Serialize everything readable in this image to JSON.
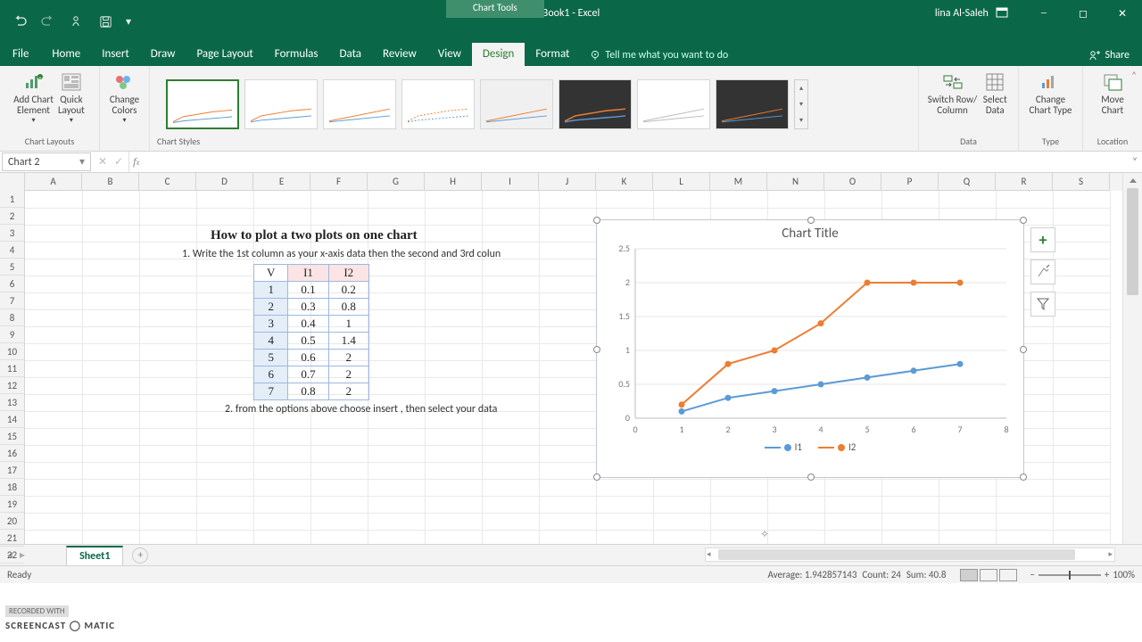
{
  "title": "Book1 - Excel",
  "chart_tools": "Chart Tools",
  "account": "lina Al-Saleh",
  "file": "File",
  "tabs": [
    "Home",
    "Insert",
    "Draw",
    "Page Layout",
    "Formulas",
    "Data",
    "Review",
    "View",
    "Design",
    "Format"
  ],
  "active_tab": "Design",
  "tellme_placeholder": "Tell me what you want to do",
  "share": "Share",
  "ribbon": {
    "add_chart_element": "Add Chart\nElement",
    "quick_layout": "Quick\nLayout",
    "change_colors": "Change\nColors",
    "group_chart_layouts": "Chart Layouts",
    "group_chart_styles": "Chart Styles",
    "switch_rowcol": "Switch Row/\nColumn",
    "select_data": "Select\nData",
    "group_data": "Data",
    "change_chart_type": "Change\nChart Type",
    "group_type": "Type",
    "move_chart": "Move\nChart",
    "group_location": "Location"
  },
  "namebox": "Chart 2",
  "columns": [
    "A",
    "B",
    "C",
    "D",
    "E",
    "F",
    "G",
    "H",
    "I",
    "J",
    "K",
    "L",
    "M",
    "N",
    "O",
    "P",
    "Q",
    "R",
    "S"
  ],
  "rows_shown": 22,
  "sheet": {
    "heading": "How to plot a two plots on one chart",
    "instr1": "1. Write the 1st column as your x-axis data then the second and 3rd colun",
    "instr2": "2. from the options above choose insert , then select your data",
    "table_headers": [
      "V",
      "I1",
      "I2"
    ],
    "table_rows": [
      [
        "1",
        "0.1",
        "0.2"
      ],
      [
        "2",
        "0.3",
        "0.8"
      ],
      [
        "3",
        "0.4",
        "1"
      ],
      [
        "4",
        "0.5",
        "1.4"
      ],
      [
        "5",
        "0.6",
        "2"
      ],
      [
        "6",
        "0.7",
        "2"
      ],
      [
        "7",
        "0.8",
        "2"
      ]
    ]
  },
  "chart_title": "Chart Title",
  "legend": {
    "s1": "I1",
    "s2": "I2"
  },
  "chart_data": {
    "type": "line",
    "x": [
      1,
      2,
      3,
      4,
      5,
      6,
      7
    ],
    "series": [
      {
        "name": "I1",
        "values": [
          0.1,
          0.3,
          0.4,
          0.5,
          0.6,
          0.7,
          0.8
        ],
        "color": "#5b9bd5"
      },
      {
        "name": "I2",
        "values": [
          0.2,
          0.8,
          1,
          1.4,
          2,
          2,
          2
        ],
        "color": "#ed7d31"
      }
    ],
    "title": "Chart Title",
    "yticks": [
      0,
      0.5,
      1,
      1.5,
      2,
      2.5
    ],
    "xticks": [
      0,
      1,
      2,
      3,
      4,
      5,
      6,
      7,
      8
    ],
    "xlim": [
      0,
      8
    ],
    "ylim": [
      0,
      2.5
    ]
  },
  "sheet_tab": "Sheet1",
  "status": {
    "ready": "Ready",
    "avg_label": "Average:",
    "avg": "1.942857143",
    "count_label": "Count:",
    "count": "24",
    "sum_label": "Sum:",
    "sum": "40.8",
    "zoom": "100%"
  },
  "watermark1": "RECORDED WITH",
  "watermark2": "SCREENCAST ◯ MATIC"
}
